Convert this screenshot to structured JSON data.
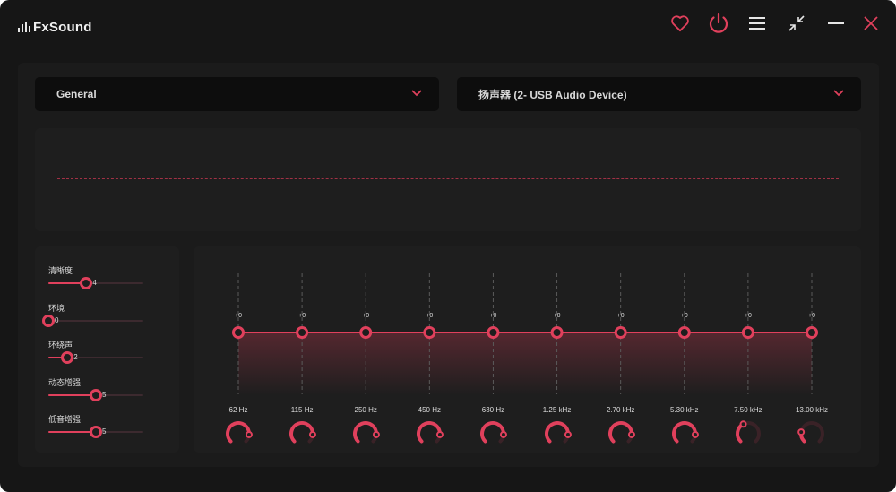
{
  "app": {
    "title": "FxSound"
  },
  "titlebar": {
    "icons": [
      "heart-icon",
      "power-icon",
      "menu-icon",
      "minimize-view-icon",
      "minimize-icon",
      "close-icon"
    ]
  },
  "preset": {
    "selected": "General"
  },
  "device": {
    "selected": "扬声器 (2- USB Audio Device)"
  },
  "effects": [
    {
      "label": "清晰度",
      "value": "4",
      "level": 0.4
    },
    {
      "label": "环境",
      "value": "0",
      "level": 0
    },
    {
      "label": "环绕声",
      "value": "2",
      "level": 0.2
    },
    {
      "label": "动态增强",
      "value": "5",
      "level": 0.5
    },
    {
      "label": "低音增强",
      "value": "5",
      "level": 0.5
    }
  ],
  "eq": {
    "bands": [
      {
        "freq": "62 Hz",
        "gain": "+0",
        "dial": 0.85
      },
      {
        "freq": "115 Hz",
        "gain": "+0",
        "dial": 0.85
      },
      {
        "freq": "250 Hz",
        "gain": "+0",
        "dial": 0.85
      },
      {
        "freq": "450 Hz",
        "gain": "+0",
        "dial": 0.85
      },
      {
        "freq": "630 Hz",
        "gain": "+0",
        "dial": 0.85
      },
      {
        "freq": "1.25 kHz",
        "gain": "+0",
        "dial": 0.85
      },
      {
        "freq": "2.70 kHz",
        "gain": "+0",
        "dial": 0.85
      },
      {
        "freq": "5.30 kHz",
        "gain": "+0",
        "dial": 0.85
      },
      {
        "freq": "7.50 kHz",
        "gain": "+0",
        "dial": 0.4
      },
      {
        "freq": "13.00 kHz",
        "gain": "+0",
        "dial": 0.2
      }
    ]
  },
  "colors": {
    "accent": "#e0405c",
    "background": "#161616",
    "panel": "#1b1b1b",
    "dropdown": "#0d0d0d",
    "text": "#dcdcdc",
    "dial_track": "#3a2227"
  }
}
